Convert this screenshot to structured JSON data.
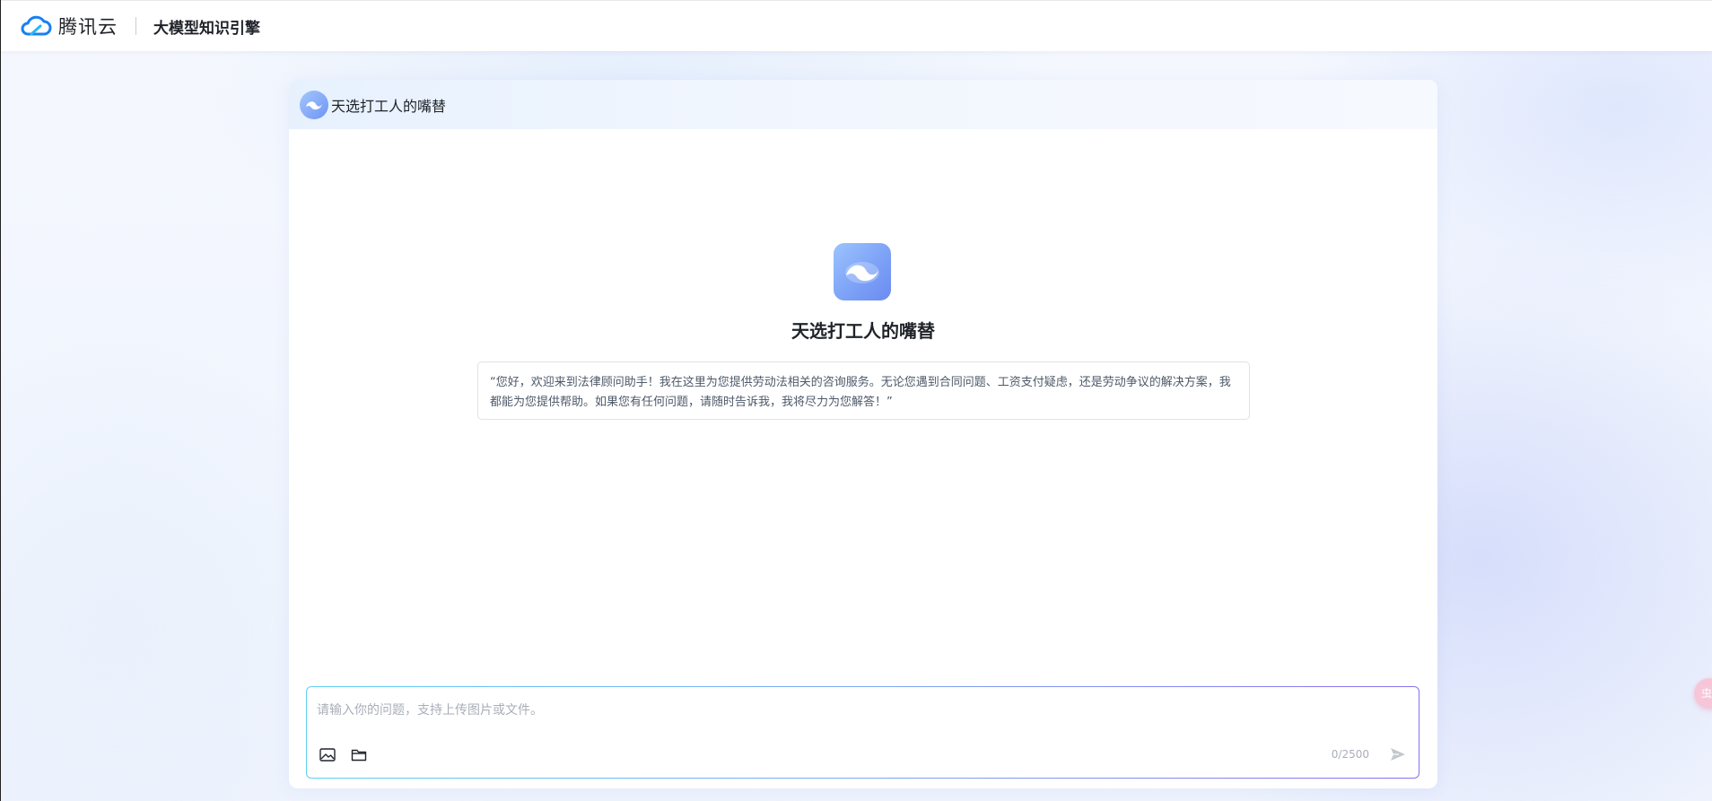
{
  "topbar": {
    "brand_name": "腾讯云",
    "product_name": "大模型知识引擎"
  },
  "chat": {
    "header_title": "天选打工人的嘴替",
    "assistant_name": "天选打工人的嘴替",
    "greeting": "“您好，欢迎来到法律顾问助手！我在这里为您提供劳动法相关的咨询服务。无论您遇到合同问题、工资支付疑虑，还是劳动争议的解决方案，我都能为您提供帮助。如果您有任何问题，请随时告诉我，我将尽力为您解答！”"
  },
  "composer": {
    "value": "",
    "placeholder": "请输入你的问题，支持上传图片或文件。",
    "counter": "0/2500",
    "image_icon": "image-icon",
    "folder_icon": "folder-icon",
    "send_icon": "send-icon"
  },
  "floating": {
    "label": "虫"
  },
  "colors": {
    "accent_blue": "#6f93f5",
    "border_gradient_start": "#5fd0f2",
    "border_gradient_end": "#8a6ff0"
  }
}
